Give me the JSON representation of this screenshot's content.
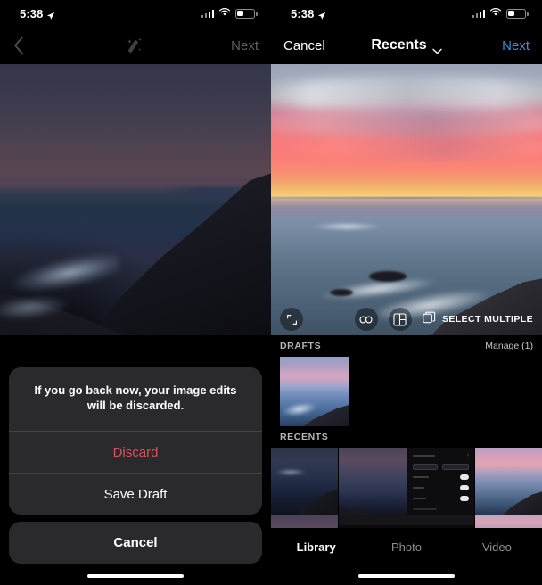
{
  "left_panel": {
    "status_bar": {
      "time": "5:38",
      "location_icon": "location-arrow-icon",
      "signal_icon": "cellular-signal-icon",
      "wifi_icon": "wifi-icon",
      "battery_icon": "battery-icon",
      "battery_level": "35"
    },
    "nav": {
      "back_icon": "chevron-left-icon",
      "wand_icon": "magic-wand-icon",
      "next_label": "Next"
    },
    "photo": {
      "name": "edited-photo-preview",
      "description": "dark twilight ocean and cliff"
    },
    "alert": {
      "message": "If you go back now, your image edits will be discarded.",
      "discard_label": "Discard",
      "save_draft_label": "Save Draft",
      "cancel_label": "Cancel",
      "destructive_color": "#d9515a"
    },
    "home_indicator": "home-indicator"
  },
  "right_panel": {
    "status_bar": {
      "time": "5:38",
      "location_icon": "location-arrow-icon",
      "signal_icon": "cellular-signal-icon",
      "wifi_icon": "wifi-icon",
      "battery_icon": "battery-icon",
      "battery_level": "35"
    },
    "nav": {
      "cancel_label": "Cancel",
      "title": "Recents",
      "title_chevron_icon": "chevron-down-icon",
      "next_label": "Next",
      "next_color": "#3a8fdc"
    },
    "photo": {
      "name": "selected-photo-preview",
      "description": "pink sunset over ocean"
    },
    "photo_toolbar": {
      "expand_icon": "expand-arrows-icon",
      "boomerang_icon": "infinity-icon",
      "layout_icon": "layout-grid-icon",
      "select_multiple_icon": "stacked-squares-icon",
      "select_multiple_label": "SELECT MULTIPLE"
    },
    "drafts": {
      "title": "DRAFTS",
      "manage_label": "Manage (1)",
      "items": [
        {
          "name": "draft-thumbnail-1"
        }
      ]
    },
    "recents": {
      "title": "RECENTS",
      "items": [
        {
          "name": "recent-thumbnail-1",
          "kind": "thumb-night"
        },
        {
          "name": "recent-thumbnail-2",
          "kind": "thumb-dusk"
        },
        {
          "name": "recent-thumbnail-3",
          "kind": "ss-sheet"
        },
        {
          "name": "recent-thumbnail-4",
          "kind": "thumb-pink"
        },
        {
          "name": "recent-thumbnail-5",
          "kind": "thumb-dusk"
        },
        {
          "name": "recent-thumbnail-6",
          "kind": "ss-app"
        },
        {
          "name": "recent-thumbnail-7",
          "kind": "ss-app"
        },
        {
          "name": "recent-thumbnail-8",
          "kind": "ss-photo-ui"
        }
      ]
    },
    "tabs": [
      {
        "label": "Library",
        "active": true
      },
      {
        "label": "Photo",
        "active": false
      },
      {
        "label": "Video",
        "active": false
      }
    ],
    "home_indicator": "home-indicator"
  }
}
